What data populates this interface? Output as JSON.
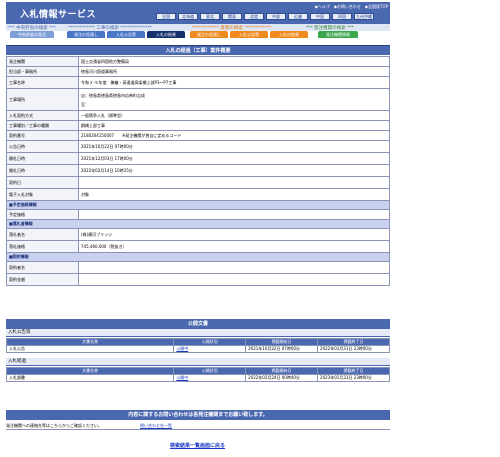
{
  "header": {
    "title": "入札情報サービス",
    "top_links": [
      "◆ヘルプ",
      "◆お問い合わせ",
      "◆全国版TOP"
    ],
    "region_tabs": [
      "全国",
      "北海道",
      "東北",
      "関東",
      "北陸",
      "中部",
      "近畿",
      "中国",
      "四国",
      "九州沖縄"
    ]
  },
  "category_bar": {
    "left": "*** 中央府省の検索 ***",
    "mid": "************ 工事の検索 **************",
    "right": "************ 業務の検索 ************",
    "far": "*** 発注機関の検索 ***"
  },
  "nav_tabs": [
    {
      "label": "中央府省の発注",
      "color": "#7ea0d8"
    },
    {
      "label": "発注の見通し",
      "color": "#4a76c8"
    },
    {
      "label": "入札公告等",
      "color": "#4a76c8"
    },
    {
      "label": "入札の結果",
      "color": "#14306e"
    },
    {
      "label": "発注の見通し",
      "color": "#f08a1e"
    },
    {
      "label": "入札公告等",
      "color": "#f08a1e"
    },
    {
      "label": "入札の結果",
      "color": "#f08a1e"
    },
    {
      "label": "発注機関情報",
      "color": "#3aa84a"
    }
  ],
  "main": {
    "title": "入札の経過（工事）案件概要",
    "rows": [
      {
        "label": "発注機関",
        "value": "国土交通省四国地方整備局"
      },
      {
        "label": "担当部・事務所",
        "value": "徳島河川国道事務所"
      },
      {
        "label": "工事名称",
        "value": "令和３-５年度　撫養・高速道高架橋上部P3～P7工事"
      },
      {
        "label": "工事場所",
        "value": "自：徳島県徳島県徳島市応神町吉成\n至："
      },
      {
        "label": "入札契約方式",
        "value": "一般競争入札（標準型）"
      },
      {
        "label": "工事種別／工事の種類",
        "value": "鋼橋上部工事"
      },
      {
        "label": "契約番号",
        "value": "2180304150007　　※発注機関が独自に定めるコード"
      },
      {
        "label": "公告日時",
        "value": "2021年10月22日 07時00分"
      },
      {
        "label": "開札日時",
        "value": "2021年12月03日 17時00分"
      },
      {
        "label": "開札日時",
        "value": "2022年02月14日 10時15分"
      },
      {
        "label": "契約日",
        "value": ""
      },
      {
        "label": "電子入札対象",
        "value": "対象"
      }
    ],
    "section_estimate": "■予定価格情報",
    "estimate_row": {
      "label": "予定価格",
      "value": ""
    },
    "section_winner": "■落札者情報",
    "winner_rows": [
      {
        "label": "落札者名",
        "value": "(株)横河ブリッジ"
      },
      {
        "label": "落札価格",
        "value": "745,460,000（税抜き）"
      }
    ],
    "section_contract": "■契約情報",
    "contract_rows": [
      {
        "label": "契約者名",
        "value": ""
      },
      {
        "label": "契約金額",
        "value": ""
      }
    ]
  },
  "documents": {
    "title": "公開文書",
    "sections": [
      {
        "title": "入札公告等",
        "columns": [
          "文書名称",
          "公開状況",
          "掲載開始日",
          "掲載終了日"
        ],
        "rows": [
          [
            "入札公告",
            "公開中",
            "2021年10月22日 07時00分",
            "2022年01月31日 23時00分"
          ]
        ]
      },
      {
        "title": "入札経過",
        "columns": [
          "文書名称",
          "公開状況",
          "掲載開始日",
          "掲載終了日"
        ],
        "rows": [
          [
            "入札調書",
            "公開中",
            "2022年02月24日 00時40分",
            "2023年01月31日 23時00分"
          ]
        ]
      }
    ]
  },
  "contact": {
    "title": "内容に関するお問い合わせは各発注機関までお願い致します。",
    "text": "発注機関への連絡先等はこちらからご確認ください。",
    "link": "問い合わせ先一覧"
  },
  "back_link": "検索結果一覧画面に戻る"
}
